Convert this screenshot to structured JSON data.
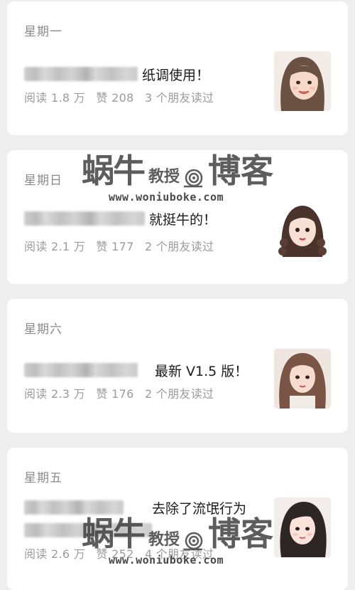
{
  "articles": [
    {
      "day": "星期一",
      "title_visible": "纸调使用！",
      "stats": {
        "reads": "阅读 1.8 万",
        "likes": "赞 208",
        "friends": "3 个朋友读过"
      },
      "thumb_icon": "avatar-girl-smiling"
    },
    {
      "day": "星期日",
      "title_visible": "就挺牛的！",
      "stats": {
        "reads": "阅读 2.1 万",
        "likes": "赞 177",
        "friends": "2 个朋友读过"
      },
      "thumb_icon": "avatar-girl-braids"
    },
    {
      "day": "星期六",
      "title_visible": "最新 V1.5 版！",
      "stats": {
        "reads": "阅读 2.3 万",
        "likes": "赞 176",
        "friends": "2 个朋友读过"
      },
      "thumb_icon": "avatar-girl-longhair"
    },
    {
      "day": "星期五",
      "title_visible": "去除了流氓行为",
      "stats": {
        "reads": "阅读 2.6 万",
        "likes": "赞 252",
        "friends": "4 个朋友读过"
      },
      "thumb_icon": "avatar-girl-dark-hair"
    }
  ],
  "watermark": {
    "big1": "蜗牛",
    "mid": "教授",
    "big2": "博客",
    "url": "www.woniuboke.com"
  }
}
